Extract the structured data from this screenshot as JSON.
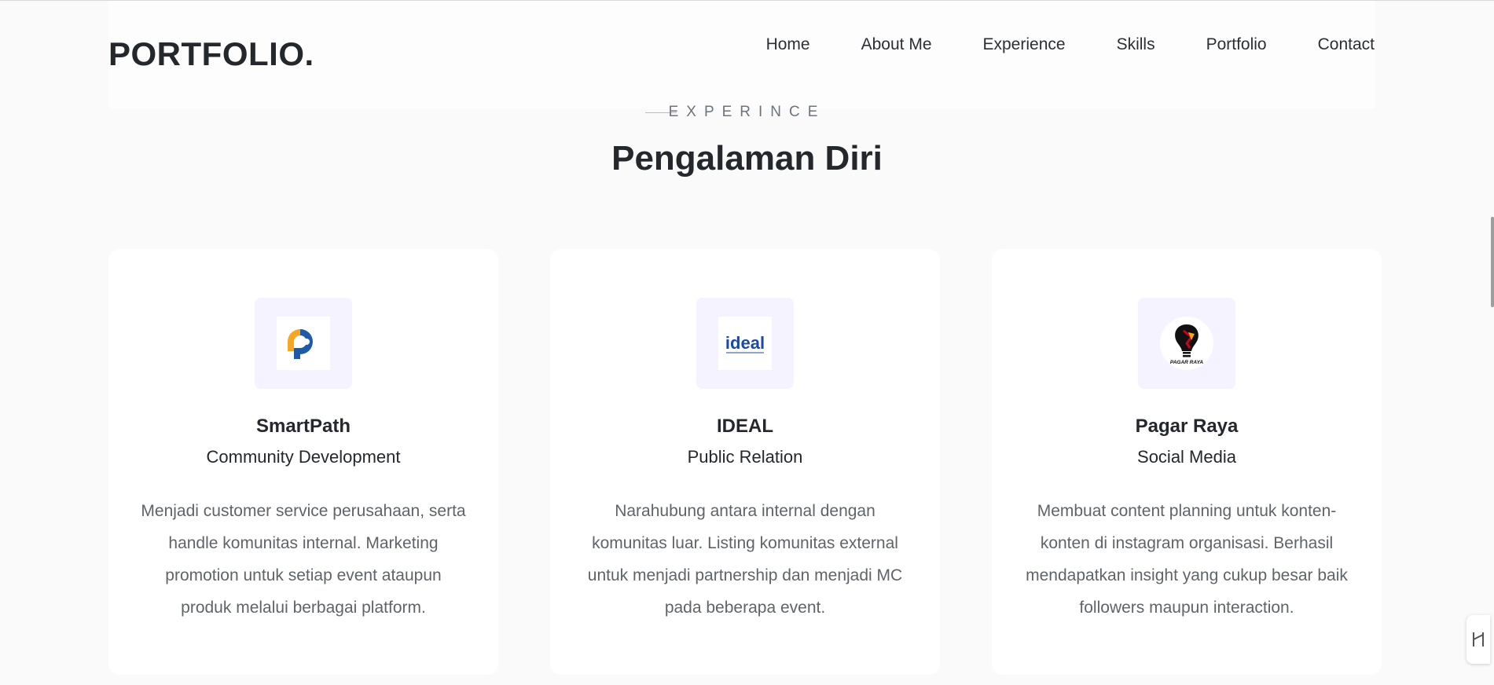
{
  "header": {
    "brand": "PORTFOLIO.",
    "nav": [
      "Home",
      "About Me",
      "Experience",
      "Skills",
      "Portfolio",
      "Contact"
    ]
  },
  "section": {
    "eyebrow": "EXPERINCE",
    "title": "Pengalaman Diri"
  },
  "cards": [
    {
      "icon": "smartpath-logo-icon",
      "company": "SmartPath",
      "role": "Community Development",
      "description": "Menjadi customer service perusahaan, serta handle komunitas internal. Marketing promotion untuk setiap event ataupun produk melalui berbagai platform."
    },
    {
      "icon": "ideal-logo-icon",
      "logo_text": "ideal",
      "company": "IDEAL",
      "role": "Public Relation",
      "description": "Narahubung antara internal dengan komunitas luar. Listing komunitas external untuk menjadi partnership dan menjadi MC pada beberapa event."
    },
    {
      "icon": "pagar-raya-logo-icon",
      "logo_text": "PAGAR RAYA",
      "company": "Pagar Raya",
      "role": "Social Media",
      "description": "Membuat content planning untuk konten-konten di instagram organisasi. Berhasil mendapatkan insight yang cukup besar baik followers maupun interaction."
    }
  ],
  "colors": {
    "background": "#fafafa",
    "card": "#ffffff",
    "icon_box": "#f4f3ff",
    "heading": "#24272b",
    "body_text": "#5f6468",
    "smartpath_orange": "#f5a623",
    "smartpath_blue": "#1f5aa6",
    "ideal_blue": "#1c4aa3"
  }
}
